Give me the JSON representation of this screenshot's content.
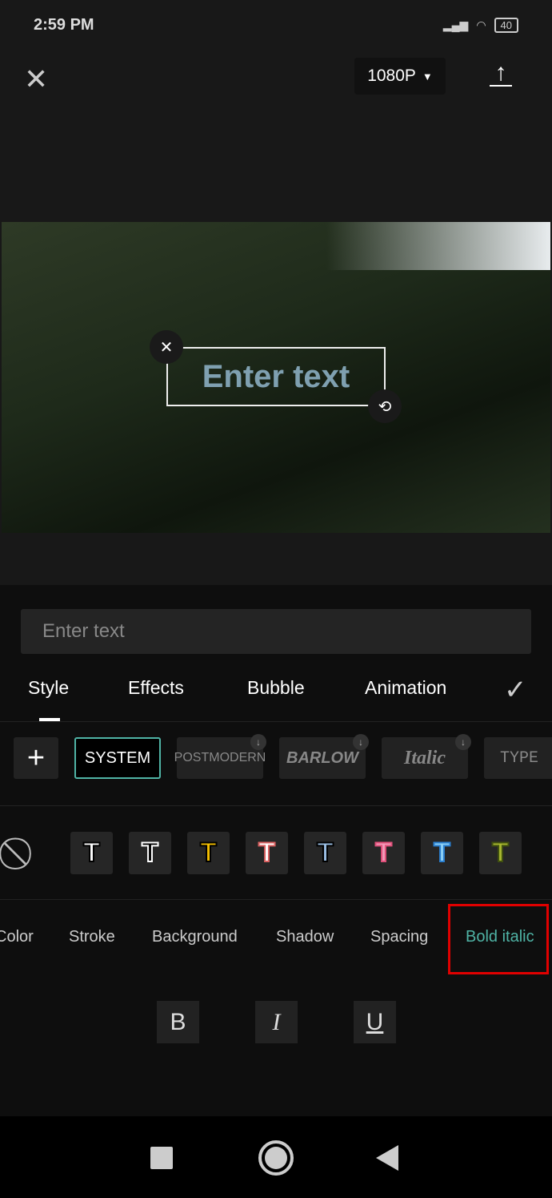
{
  "status_bar": {
    "time": "2:59 PM",
    "battery": "40"
  },
  "header": {
    "resolution": "1080P"
  },
  "canvas": {
    "text": "Enter text"
  },
  "text_input": {
    "placeholder": "Enter text"
  },
  "tabs": [
    {
      "label": "Style"
    },
    {
      "label": "Effects"
    },
    {
      "label": "Bubble"
    },
    {
      "label": "Animation"
    }
  ],
  "fonts": [
    {
      "label": "SYSTEM",
      "selected": true
    },
    {
      "label": "POSTMODERN"
    },
    {
      "label": "BARLOW"
    },
    {
      "label": "Italic"
    },
    {
      "label": "TYPE"
    }
  ],
  "style_presets": [
    {
      "fill": "#ffffff",
      "stroke": "#000000"
    },
    {
      "fill": "#000000",
      "stroke": "#ffffff"
    },
    {
      "fill": "#f5c000",
      "stroke": "#000000"
    },
    {
      "fill": "#ffffff",
      "stroke": "#d96060"
    },
    {
      "fill": "#9cc0e6",
      "stroke": "#000000"
    },
    {
      "fill": "#f29ab8",
      "stroke": "#e0507a"
    },
    {
      "fill": "#8cd0f5",
      "stroke": "#2a7fd0"
    },
    {
      "fill": "#a8b830",
      "stroke": "#405010"
    }
  ],
  "properties": [
    {
      "label": "Color"
    },
    {
      "label": "Stroke"
    },
    {
      "label": "Background"
    },
    {
      "label": "Shadow"
    },
    {
      "label": "Spacing"
    },
    {
      "label": "Bold italic",
      "active": true
    }
  ],
  "format_buttons": [
    {
      "label": "B"
    },
    {
      "label": "I"
    },
    {
      "label": "U"
    }
  ],
  "colors": {
    "accent": "#4fb3a5",
    "highlight": "#e00000"
  }
}
